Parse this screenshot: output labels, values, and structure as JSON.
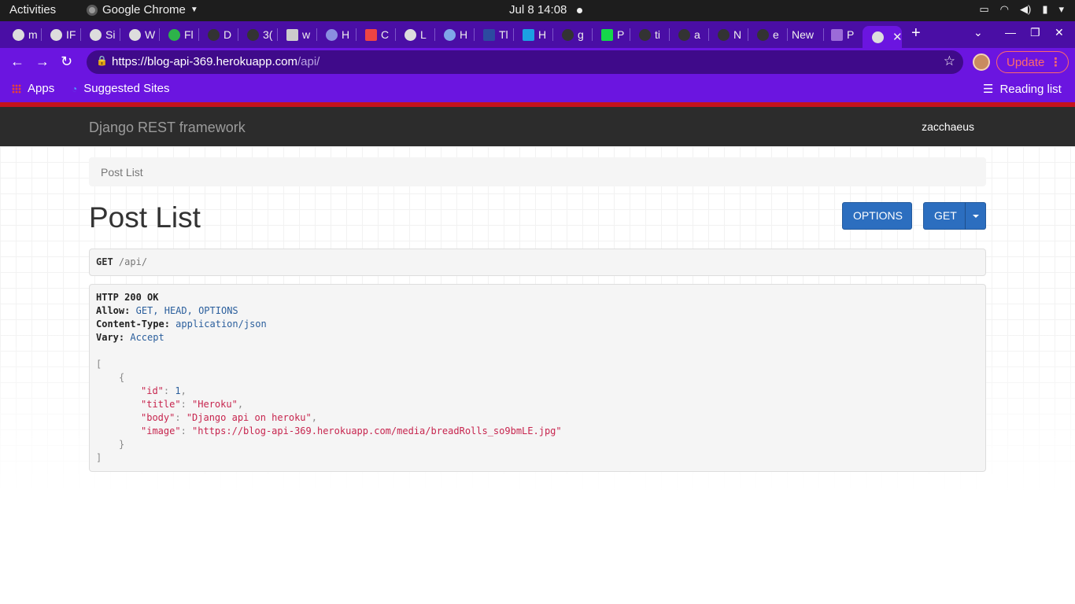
{
  "system_bar": {
    "activities": "Activities",
    "app_name": "Google Chrome",
    "clock": "Jul 8  14:08"
  },
  "tabs": [
    {
      "label": "m"
    },
    {
      "label": "IF"
    },
    {
      "label": "Si"
    },
    {
      "label": "W"
    },
    {
      "label": "Fl"
    },
    {
      "label": "D"
    },
    {
      "label": "3("
    },
    {
      "label": "w"
    },
    {
      "label": "H"
    },
    {
      "label": "C"
    },
    {
      "label": "L"
    },
    {
      "label": "H"
    },
    {
      "label": "Tl"
    },
    {
      "label": "H"
    },
    {
      "label": "g"
    },
    {
      "label": "P"
    },
    {
      "label": "ti"
    },
    {
      "label": "a"
    },
    {
      "label": "N"
    },
    {
      "label": "e"
    },
    {
      "label": "New"
    },
    {
      "label": "P"
    },
    {
      "label": ""
    }
  ],
  "toolbar": {
    "url_host": "https://blog-api-369.herokuapp.com",
    "url_path": "/api/",
    "update_label": "Update"
  },
  "bookmarks": {
    "apps": "Apps",
    "suggested": "Suggested Sites",
    "reading_list": "Reading list"
  },
  "drf": {
    "brand": "Django REST framework",
    "user": "zacchaeus",
    "breadcrumb": "Post List",
    "title": "Post List",
    "options_label": "OPTIONS",
    "get_label": "GET",
    "request_method": "GET",
    "request_path": "/api/"
  },
  "response": {
    "status": "HTTP 200 OK",
    "headers": [
      {
        "name": "Allow:",
        "value": "GET, HEAD, OPTIONS"
      },
      {
        "name": "Content-Type:",
        "value": "application/json"
      },
      {
        "name": "Vary:",
        "value": "Accept"
      }
    ],
    "body": {
      "open_bracket": "[",
      "open_brace": "{",
      "id_key": "\"id\"",
      "id_value": "1",
      "title_key": "\"title\"",
      "title_value": "\"Heroku\"",
      "body_key": "\"body\"",
      "body_value": "\"Django api on heroku\"",
      "image_key": "\"image\"",
      "image_value": "\"https://blog-api-369.herokuapp.com/media/breadRolls_so9bmLE.jpg\"",
      "close_brace": "}",
      "close_bracket": "]"
    }
  },
  "colors": {
    "tab_strip": "#4a0ea5",
    "toolbar": "#6b15e0",
    "drf_nav": "#2c2c2c",
    "button": "#2c6ebf",
    "json_string": "#c7254e"
  }
}
